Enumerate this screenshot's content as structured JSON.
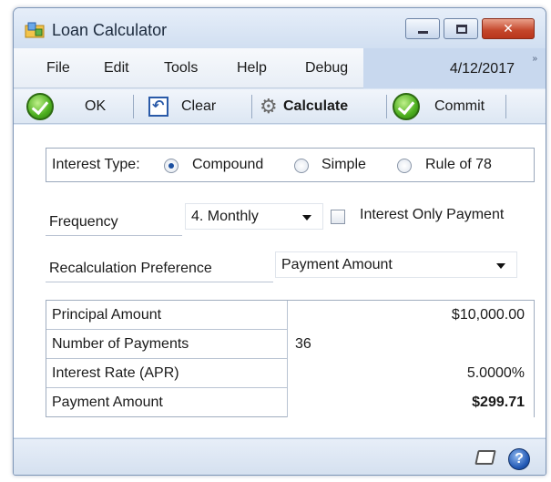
{
  "window": {
    "title": "Loan Calculator",
    "icon": "loan-calculator-app-icon",
    "controls": {
      "minimize": "minimize-icon",
      "maximize": "maximize-icon",
      "close": "close-icon"
    }
  },
  "menubar": {
    "items": [
      "File",
      "Edit",
      "Tools",
      "Help",
      "Debug"
    ],
    "date": "4/12/2017",
    "more": "»"
  },
  "toolbar": {
    "ok_label": "OK",
    "clear_label": "Clear",
    "calculate_label": "Calculate",
    "commit_label": "Commit"
  },
  "interest_type": {
    "label": "Interest Type:",
    "options": [
      "Compound",
      "Simple",
      "Rule of 78"
    ],
    "selected": "Compound"
  },
  "frequency": {
    "label": "Frequency",
    "value": "4. Monthly",
    "interest_only_label": "Interest Only Payment",
    "interest_only_checked": false
  },
  "recalculation": {
    "label": "Recalculation Preference",
    "value": "Payment Amount"
  },
  "calc_fields": [
    {
      "label": "Principal Amount",
      "value": "$10,000.00"
    },
    {
      "label": "Number of Payments",
      "value": "36"
    },
    {
      "label": "Interest Rate (APR)",
      "value": "5.0000%"
    },
    {
      "label": "Payment Amount",
      "value": "$299.71"
    }
  ],
  "colors": {
    "accent": "#1b4fa0",
    "close_button": "#c4452a",
    "ok_green": "#4cae1e"
  }
}
